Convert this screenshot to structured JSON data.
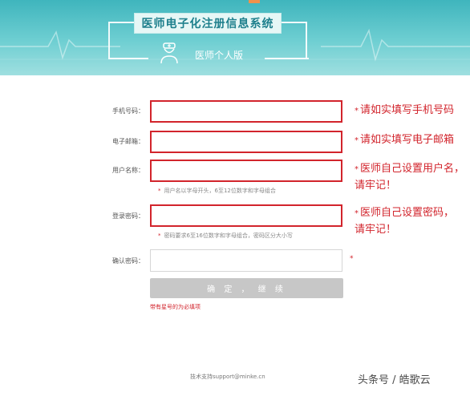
{
  "header": {
    "title": "医师电子化注册信息系统",
    "subtitle": "医师个人版"
  },
  "form": {
    "phone_label": "手机号码：",
    "email_label": "电子邮箱：",
    "username_label": "用户名称：",
    "username_hint": "用户名以字母开头，6至12位数字和字母组合",
    "password_label": "登录密码：",
    "password_hint": "密码要求6至16位数字和字母组合，密码区分大小写",
    "confirm_label": "确认密码：",
    "submit_label": "确 定 ， 继 续",
    "required_note": "带有星号的为必填项",
    "star": "*"
  },
  "annotations": {
    "phone": "请如实填写手机号码",
    "email": "请如实填写电子邮箱",
    "username_line1": "医师自己设置用户名，",
    "username_line2": "请牢记！",
    "password_line1": "医师自己设置密码，",
    "password_line2": "请牢记！"
  },
  "footer": {
    "support": "技术支持support@minke.cn",
    "watermark": "头条号 / 皓歌云"
  },
  "colors": {
    "banner": "#4fbfc5",
    "accent_red": "#d2242c",
    "submit_disabled": "#c7c7c7"
  }
}
